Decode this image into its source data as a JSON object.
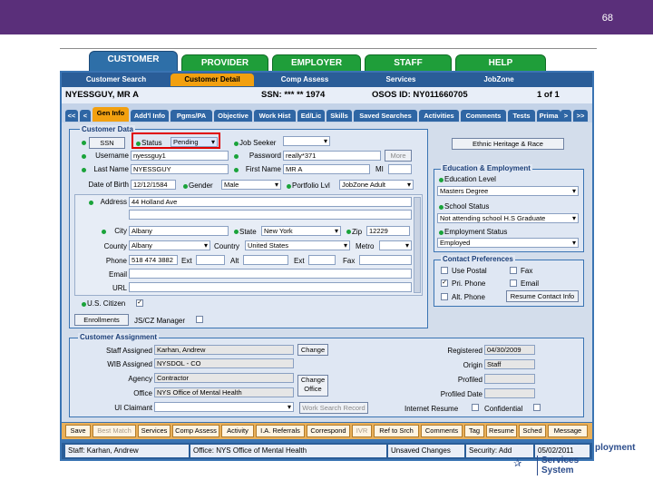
{
  "slide": {
    "number": "68"
  },
  "tabs": {
    "customer": "CUSTOMER",
    "provider": "PROVIDER",
    "employer": "EMPLOYER",
    "staff": "STAFF",
    "help": "HELP"
  },
  "subtabs": [
    "Customer Search",
    "Customer Detail",
    "Comp Assess",
    "Services",
    "JobZone"
  ],
  "info": {
    "name": "NYESSGUY, MR A",
    "ssn": "SSN: *** ** 1974",
    "osos": "OSOS ID: NY011660705",
    "page": "1 of 1"
  },
  "tabrow": {
    "first": "<<",
    "prev": "<",
    "items": [
      "Gen Info",
      "Add'l Info",
      "Pgms/PA",
      "Objective",
      "Work Hist",
      "Ed/Lic",
      "Skills",
      "Saved Searches",
      "Activities",
      "Comments",
      "Tests",
      "Prima"
    ],
    "next": ">",
    "last": ">>"
  },
  "customer_data": {
    "title": "Customer Data",
    "ssn_button": "SSN",
    "status_label": "Status",
    "status_value": "Pending",
    "job_seeker_label": "Job Seeker",
    "job_seeker_value": "",
    "username_label": "Username",
    "username_value": "nyessguy1",
    "password_label": "Password",
    "password_value": "really*371",
    "more_button": "More",
    "last_name_label": "Last Name",
    "last_name_value": "NYESSGUY",
    "first_name_label": "First Name",
    "first_name_value": "MR A",
    "mi_label": "MI",
    "mi_value": "",
    "dob_label": "Date of Birth",
    "dob_value": "12/12/1584",
    "gender_label": "Gender",
    "gender_value": "Male",
    "portfolio_label": "Portfolio Lvl",
    "portfolio_value": "JobZone Adult",
    "address_label": "Address",
    "address_value": "44 Holland Ave",
    "city_label": "City",
    "city_value": "Albany",
    "state_label": "State",
    "state_value": "New York",
    "zip_label": "Zip",
    "zip_value": "12229",
    "county_label": "County",
    "county_value": "Albany",
    "country_label": "Country",
    "country_value": "United States",
    "metro_label": "Metro",
    "metro_value": "",
    "phone_label": "Phone",
    "phone_value": "518 474 3882",
    "ext_label": "Ext",
    "alt_label": "Alt",
    "fax_label": "Fax",
    "email_label": "Email",
    "url_label": "URL",
    "us_citizen_label": "U.S. Citizen",
    "enrollments_button": "Enrollments",
    "jszz_label": "JS/CZ Manager"
  },
  "ethnic_button": "Ethnic Heritage & Race",
  "education": {
    "title": "Education & Employment",
    "edu_level_label": "Education Level",
    "edu_level_value": "Masters Degree",
    "school_label": "School Status",
    "school_value": "Not attending school H.S Graduate",
    "emp_label": "Employment Status",
    "emp_value": "Employed"
  },
  "contact": {
    "title": "Contact Preferences",
    "use_postal": "Use Postal",
    "fax": "Fax",
    "pri_phone": "Pri. Phone",
    "email": "Email",
    "alt_phone": "Alt. Phone",
    "resume_button": "Resume Contact Info"
  },
  "assignment": {
    "title": "Customer Assignment",
    "staff_label": "Staff Assigned",
    "staff_value": "Karhan, Andrew",
    "change_button": "Change",
    "wib_label": "WIB Assigned",
    "wib_value": "NYSDOL - CO",
    "agency_label": "Agency",
    "agency_value": "Contractor",
    "office_label": "Office",
    "office_value": "NYS Office of Mental Health",
    "change_office_button": "Change Office",
    "ui_label": "UI Claimant",
    "ui_value": "",
    "work_search_button": "Work Search Record",
    "registered_label": "Registered",
    "registered_value": "04/30/2009",
    "origin_label": "Origin",
    "origin_value": "Staff",
    "profiled_label": "Profiled",
    "profiled_value": "",
    "profiled_date_label": "Profiled Date",
    "profiled_date_value": "",
    "internet_resume_label": "Internet Resume",
    "confidential_label": "Confidential"
  },
  "bottom_buttons": [
    "Save",
    "Best Match",
    "Services",
    "Comp Assess",
    "Activity",
    "I.A. Referrals",
    "Correspond",
    "IVR",
    "Ref to Srch",
    "Comments",
    "Tag",
    "Resume",
    "Sched",
    "Message"
  ],
  "status": {
    "staff": "Staff: Karhan, Andrew",
    "office": "Office: NYS Office of Mental Health",
    "unsaved": "Unsaved Changes",
    "security": "Security: Add",
    "date": "05/02/2011"
  },
  "logo": {
    "line1": "ployment",
    "line2": "Services System"
  }
}
